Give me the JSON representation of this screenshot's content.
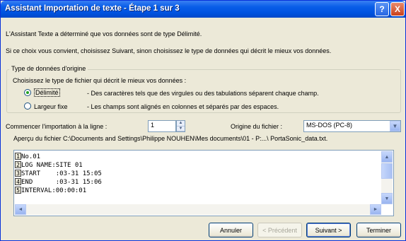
{
  "window": {
    "title": "Assistant Importation de texte - Étape 1 sur 3",
    "help_label": "?",
    "close_label": "X"
  },
  "intro": {
    "line1": "L'Assistant Texte a déterminé que vos données sont de type Délimité.",
    "line2": "Si ce choix vous convient, choisissez Suivant, sinon choisissez le type de données qui décrit le mieux vos données."
  },
  "group": {
    "title": "Type de données d'origine",
    "subtitle": "Choisissez le type de fichier qui décrit le mieux vos données :",
    "options": [
      {
        "label": "Délimité",
        "description": "- Des caractères tels que des virgules ou des tabulations séparent chaque champ.",
        "selected": true
      },
      {
        "label": "Largeur fixe",
        "description": "- Les champs sont alignés en colonnes et séparés par des espaces.",
        "selected": false
      }
    ]
  },
  "start_row": {
    "label": "Commencer l'importation à la ligne :",
    "value": "1"
  },
  "origin": {
    "label": "Origine du fichier :",
    "value": "MS-DOS (PC-8)"
  },
  "preview": {
    "label": "Aperçu du fichier C:\\Documents and Settings\\Philippe NOUHEN\\Mes documents\\01 - P:...\\ PortaSonic_data.txt.",
    "rows": [
      {
        "num": "1",
        "text": "No.01"
      },
      {
        "num": "2",
        "text": "LOG NAME:SITE 01"
      },
      {
        "num": "3",
        "text": "START    :03-31 15:05"
      },
      {
        "num": "4",
        "text": "END      :03-31 15:06"
      },
      {
        "num": "5",
        "text": "INTERVAL:00:00:01"
      }
    ]
  },
  "buttons": {
    "cancel": "Annuler",
    "previous": "< Précédent",
    "next": "Suivant >",
    "finish": "Terminer"
  },
  "icons": {
    "spin_up": "▲",
    "spin_down": "▼",
    "dropdown": "▼",
    "scroll_up": "▲",
    "scroll_down": "▼",
    "scroll_left": "◄",
    "scroll_right": "►"
  }
}
